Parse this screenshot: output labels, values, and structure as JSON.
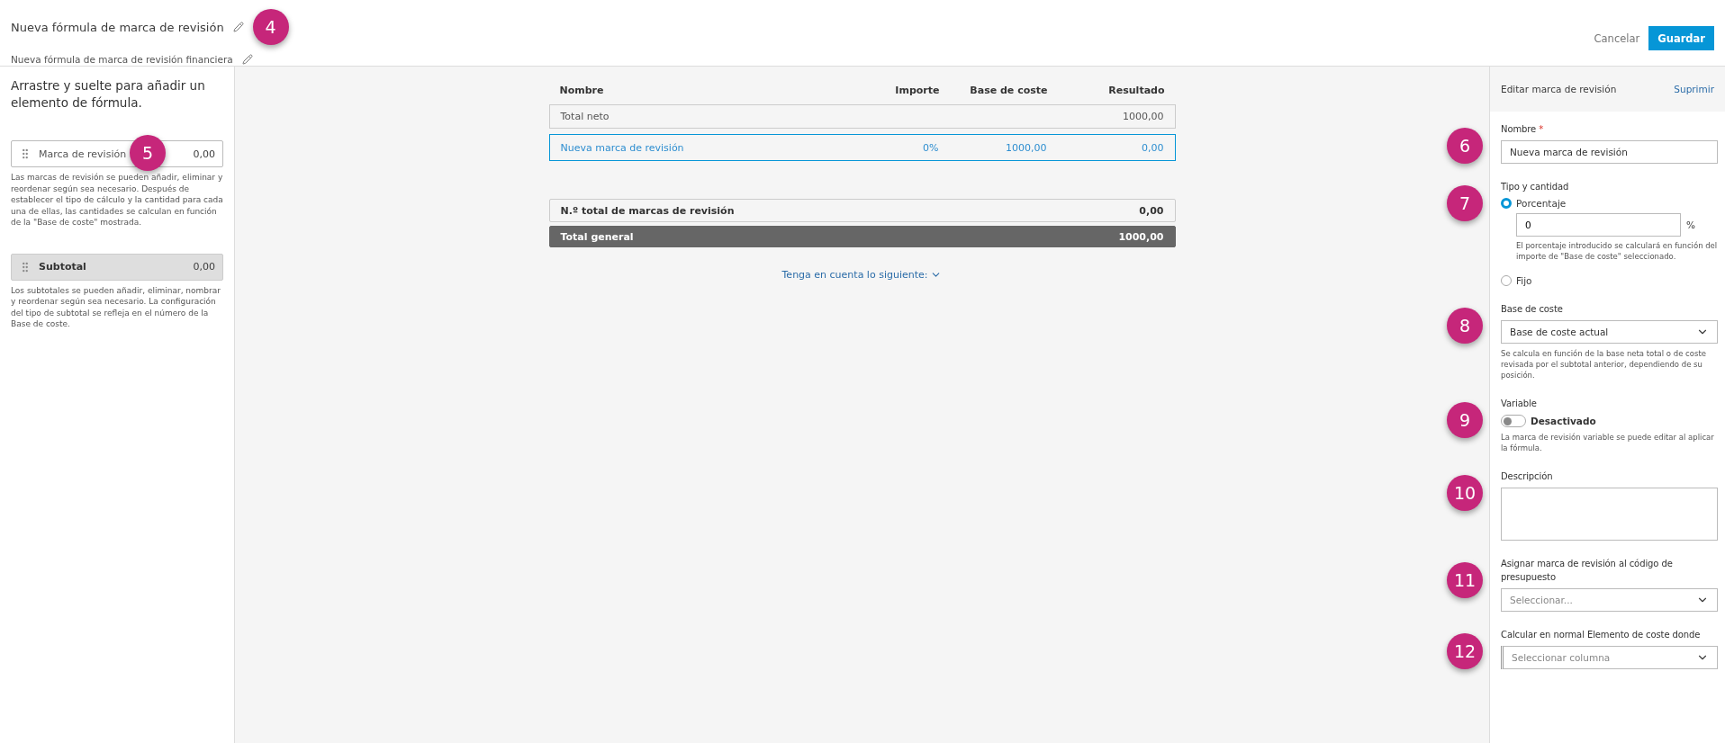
{
  "header": {
    "title": "Nueva fórmula de marca de revisión",
    "title_callout": "4",
    "subtitle": "Nueva fórmula de marca de revisión financiera",
    "cancel": "Cancelar",
    "save": "Guardar"
  },
  "palette": {
    "instruction": "Arrastre y suelte para añadir un elemento de fórmula.",
    "items": [
      {
        "kind": "markup",
        "label": "Marca de revisión",
        "value": "0,00",
        "callout": "5",
        "note": "Las marcas de revisión se pueden añadir, eliminar y reordenar según sea necesario. Después de establecer el tipo de cálculo y la cantidad para cada una de ellas, las cantidades se calculan en función de la \"Base de coste\" mostrada."
      },
      {
        "kind": "subtotal",
        "label": "Subtotal",
        "value": "0,00",
        "note": "Los subtotales se pueden añadir, eliminar, nombrar y reordenar según sea necesario. La configuración del tipo de subtotal se refleja en el número de la Base de coste."
      }
    ]
  },
  "table": {
    "columns": [
      "Nombre",
      "Importe",
      "Base de coste",
      "Resultado"
    ],
    "rows": [
      {
        "selected": false,
        "cells": [
          "Total neto",
          "",
          "",
          "1000,00"
        ]
      },
      {
        "selected": true,
        "cells": [
          "Nueva marca de revisión",
          "0%",
          "1000,00",
          "0,00"
        ]
      }
    ],
    "summary": [
      {
        "kind": "count",
        "label": "N.º total de marcas de revisión",
        "value": "0,00"
      },
      {
        "kind": "grand",
        "label": "Total general",
        "value": "1000,00"
      }
    ],
    "note_link": "Tenga en cuenta lo siguiente:"
  },
  "editor": {
    "title": "Editar marca de revisión",
    "delete": "Suprimir",
    "fields": [
      {
        "kind": "text",
        "callout": "6",
        "label": "Nombre",
        "required_mark": "*",
        "value": "Nueva marca de revisión"
      },
      {
        "kind": "radio",
        "callout": "7",
        "label": "Tipo y cantidad",
        "options": [
          {
            "label": "Porcentaje",
            "selected": true,
            "value": "0",
            "suffix": "%",
            "help": "El porcentaje introducido se calculará en función del importe de \"Base de coste\" seleccionado."
          },
          {
            "label": "Fijo",
            "selected": false
          }
        ]
      },
      {
        "kind": "select",
        "callout": "8",
        "label": "Base de coste",
        "value": "Base de coste actual",
        "help": "Se calcula en función de la base neta total o de coste revisada por el subtotal anterior, dependiendo de su posición."
      },
      {
        "kind": "toggle",
        "callout": "9",
        "label": "Variable",
        "on": false,
        "state_label": "Desactivado",
        "help": "La marca de revisión variable se puede editar al aplicar la fórmula."
      },
      {
        "kind": "textarea",
        "callout": "10",
        "label": "Descripción"
      },
      {
        "kind": "select",
        "callout": "11",
        "label": "Asignar marca de revisión al código de presupuesto",
        "placeholder": "Seleccionar..."
      },
      {
        "kind": "select",
        "callout": "12",
        "label": "Calcular en normal Elemento de coste donde",
        "placeholder": "Seleccionar columna",
        "marker": true
      }
    ]
  }
}
